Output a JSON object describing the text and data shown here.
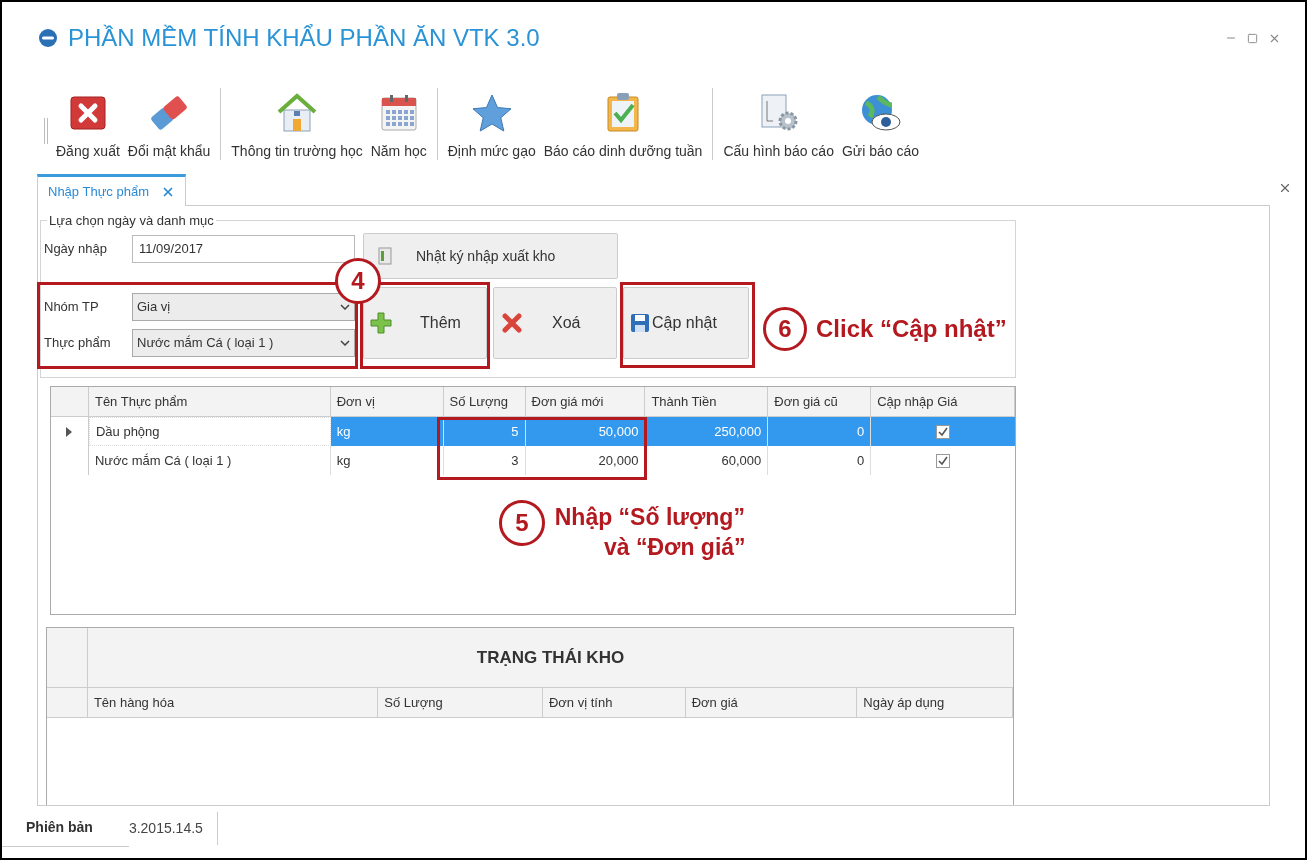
{
  "window": {
    "title": "PHẦN MỀM TÍNH KHẨU PHẦN ĂN VTK 3.0"
  },
  "toolbar": {
    "groups": [
      [
        "Đăng xuất",
        "Đổi mật khẩu"
      ],
      [
        "Thông tin trường học",
        "Năm học"
      ],
      [
        "Định mức gạo",
        "Báo cáo dinh dưỡng tuần"
      ],
      [
        "Cấu hình báo cáo",
        "Gửi báo cáo"
      ]
    ]
  },
  "tabs": [
    {
      "label": "Nhập Thực phẩm",
      "selected": true
    }
  ],
  "form": {
    "legend": "Lựa chọn ngày và danh mục",
    "fields": [
      {
        "label": "Ngày nhập",
        "value": "11/09/2017",
        "kind": "text"
      },
      {
        "label": "Nhóm TP",
        "value": "Gia vị",
        "kind": "select"
      },
      {
        "label": "Thực phẩm",
        "value": "Nước mắm Cá ( loại 1 )",
        "kind": "select"
      }
    ]
  },
  "buttons": [
    "Nhật ký nhập xuất kho",
    "Thêm",
    "Xoá",
    "Cập nhật"
  ],
  "table": {
    "columns": [
      "Tên Thực phẩm",
      "Đơn vị",
      "Số Lượng",
      "Đơn giá mới",
      "Thành Tiền",
      "Đơn giá cũ",
      "Cập nhập Giá"
    ],
    "rows": [
      {
        "selected": true,
        "cells": [
          "Dầu phộng",
          "kg",
          "5",
          "50,000",
          "250,000",
          "0"
        ],
        "checked": true
      },
      {
        "selected": false,
        "cells": [
          "Nước mắm Cá ( loại 1 )",
          "kg",
          "3",
          "20,000",
          "60,000",
          "0"
        ],
        "checked": true
      }
    ]
  },
  "stock_table": {
    "title": "TRẠNG THÁI KHO",
    "columns": [
      "Tên hàng hóa",
      "Số Lượng",
      "Đơn vị tính",
      "Đơn giá",
      "Ngày áp dụng"
    ]
  },
  "status_bar": {
    "label": "Phiên bản",
    "value": "3.2015.14.5"
  },
  "annotations": [
    {
      "number": "4"
    },
    {
      "number": "5",
      "lines": [
        "Nhập “Số lượng”",
        "và “Đơn giá”"
      ]
    },
    {
      "number": "6",
      "lines": [
        "Click “Cập nhật”"
      ]
    }
  ]
}
